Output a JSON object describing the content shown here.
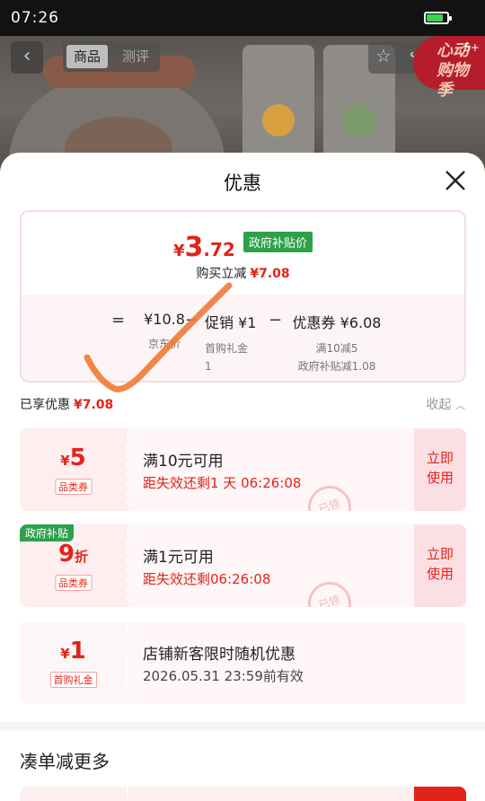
{
  "status_bar": {
    "time": "07:26",
    "battery_level": 0.8,
    "battery_color": "#3bd34f"
  },
  "background_page": {
    "tabs": [
      {
        "label": "商品",
        "active": true
      },
      {
        "label": "测评",
        "active": false
      }
    ],
    "cart_badge": {
      "text": "心动购物季",
      "count": "5+"
    }
  },
  "sheet": {
    "title": "优惠",
    "summary": {
      "currency": "¥",
      "price_int": "3",
      "price_dec": ".72",
      "tag": "政府补贴价",
      "buy_cut_label": "购买立减",
      "buy_cut_value": "¥7.08",
      "formula": {
        "eq": "=",
        "jd_price": "¥10.8",
        "jd_price_label": "京东价",
        "minus1": "−",
        "promo": "促销 ¥1",
        "promo_label_1": "首购礼金",
        "promo_label_2": "1",
        "minus2": "−",
        "coupon": "优惠券 ¥6.08",
        "coupon_label_1": "满10减5",
        "coupon_label_2": "政府补贴减1.08"
      }
    },
    "enjoyed": {
      "label": "已享优惠",
      "value": "¥7.08"
    },
    "collapse_label": "收起",
    "coupons": [
      {
        "currency": "¥",
        "amount": "5",
        "tag": "品类券",
        "title": "满10元可用",
        "expiry": "距失效还剩1 天 06:26:08",
        "action": "立即使用",
        "action_1": "立即",
        "action_2": "使用",
        "stamp": "已领"
      },
      {
        "corner": "政府补贴",
        "amount": "9",
        "unit": "折",
        "tag": "品类券",
        "title": "满1元可用",
        "expiry": "距失效还剩06:26:08",
        "action_1": "立即",
        "action_2": "使用",
        "stamp": "已领"
      },
      {
        "currency": "¥",
        "amount": "1",
        "tag": "首购礼金",
        "title": "店铺新客限时随机优惠",
        "expiry": "2026.05.31 23:59前有效"
      }
    ],
    "more_title": "凑单减更多"
  },
  "colors": {
    "accent": "#e2231a",
    "gov_green": "#2fa04a",
    "annotation": "#f07a35"
  }
}
